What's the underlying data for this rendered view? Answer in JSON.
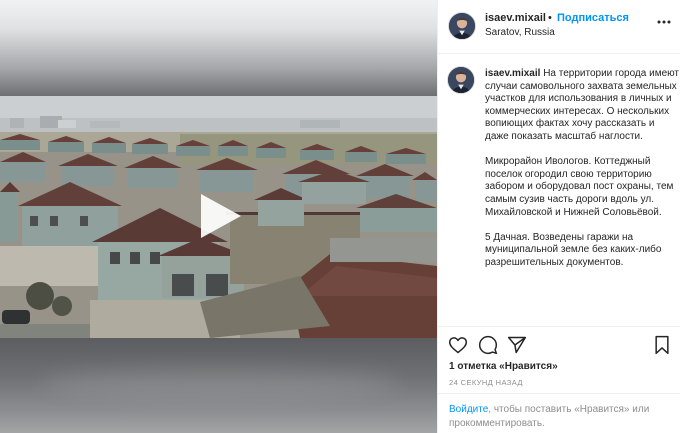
{
  "header": {
    "username": "isaev.mixail",
    "separator": "•",
    "follow_label": "Подписаться",
    "location": "Saratov, Russia",
    "more_icon": "more-horizontal-icon"
  },
  "caption": {
    "username": "isaev.mixail",
    "paragraphs": [
      "На территории города имеют случаи самовольного захвата земельных участков для использования в личных и коммерческих интересах. О нескольких вопиющих фактах хочу рассказать и даже показать масштаб наглости.",
      "Микрорайон Ивологов. Коттеджный поселок огородил свою территорию забором и оборудовал пост охраны, тем самым сузив часть дороги вдоль ул. Михайловской и Нижней Соловьёвой.",
      "5 Дачная. Возведены гаражи на муниципальной земле без каких-либо разрешительных документов."
    ]
  },
  "actions": {
    "icons": [
      "heart-icon",
      "comment-icon",
      "share-icon",
      "bookmark-icon"
    ]
  },
  "likes_text": "1 отметка «Нравится»",
  "timestamp": "24 СЕКУНД НАЗАД",
  "login": {
    "link": "Войдите",
    "rest": ", чтобы поставить «Нравится» или прокомментировать."
  },
  "media": {
    "type": "video",
    "play_icon": "play-icon"
  },
  "colors": {
    "accent": "#0095f6",
    "text": "#262626",
    "muted": "#8e8e8e",
    "border": "#efefef"
  }
}
